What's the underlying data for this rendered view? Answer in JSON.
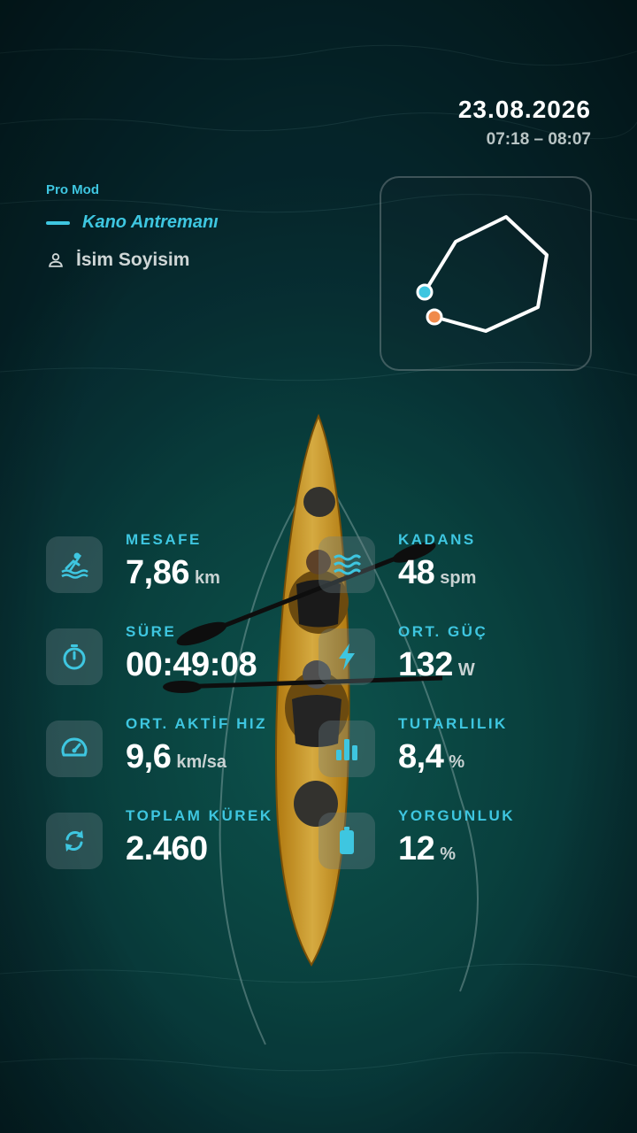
{
  "header": {
    "date": "23.08.2026",
    "time_range": "07:18 – 08:07"
  },
  "workout": {
    "mode": "Pro Mod",
    "activity": "Kano Antremanı",
    "user_name": "İsim Soyisim"
  },
  "colors": {
    "accent": "#3ec6e0",
    "route_start": "#3ec6e0",
    "route_end": "#f08a4b",
    "route_line": "#ffffff"
  },
  "stats_left": [
    {
      "label": "MESAFE",
      "value": "7,86",
      "unit": "km",
      "icon": "kayak-icon"
    },
    {
      "label": "SÜRE",
      "value": "00:49:08",
      "unit": "",
      "icon": "stopwatch-icon"
    },
    {
      "label": "ORT. AKTİF HIZ",
      "value": "9,6",
      "unit": "km/sa",
      "icon": "speedometer-icon"
    },
    {
      "label": "TOPLAM KÜREK",
      "value": "2.460",
      "unit": "",
      "icon": "refresh-icon"
    }
  ],
  "stats_right": [
    {
      "label": "KADANS",
      "value": "48",
      "unit": "spm",
      "icon": "waves-icon"
    },
    {
      "label": "ORT. GÜÇ",
      "value": "132",
      "unit": "W",
      "icon": "lightning-icon"
    },
    {
      "label": "TUTARLILIK",
      "value": "8,4",
      "unit": "%",
      "icon": "bar-chart-icon"
    },
    {
      "label": "YORGUNLUK",
      "value": "12",
      "unit": "%",
      "icon": "battery-icon"
    }
  ]
}
